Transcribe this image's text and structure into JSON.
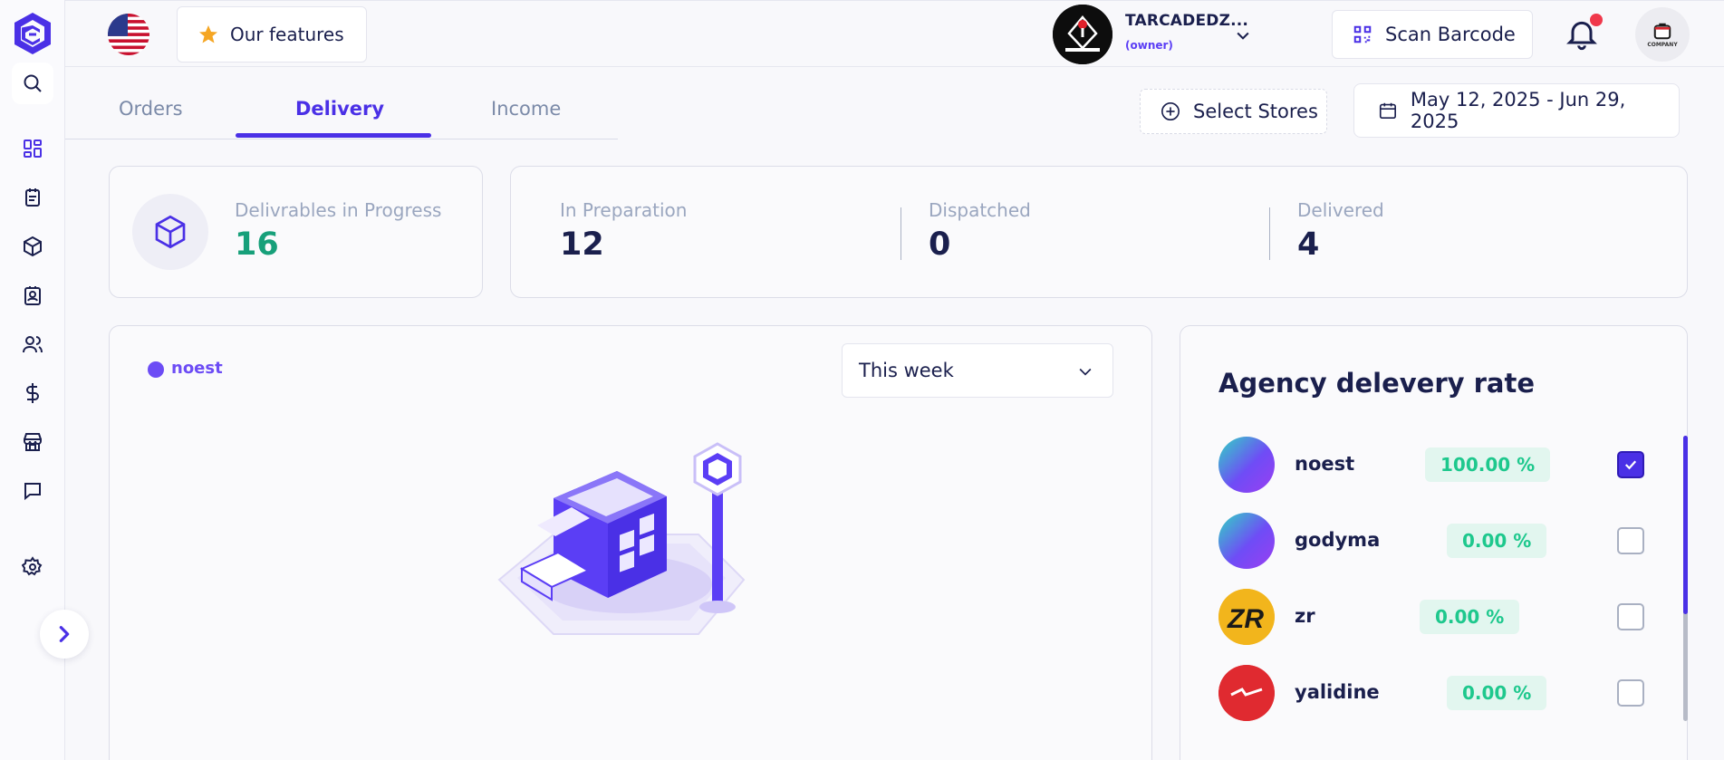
{
  "colors": {
    "accent": "#4a30e6",
    "value_green": "#17a07a",
    "rate_green": "#1ec88d",
    "legend_purple": "#6c4cf5",
    "notification": "#f0384b"
  },
  "sidebar": {
    "icons": [
      "dashboard-icon",
      "orders-icon",
      "products-icon",
      "contacts-icon",
      "users-icon",
      "dollar-icon",
      "store-icon",
      "chat-icon",
      "settings-icon"
    ]
  },
  "header": {
    "features_label": "Our features",
    "account": {
      "name": "TARCADEDZ...",
      "role": "(owner)"
    },
    "scan_label": "Scan Barcode",
    "company_label": "COMPANY"
  },
  "tabs": [
    {
      "label": "Orders",
      "active": false
    },
    {
      "label": "Delivery",
      "active": true
    },
    {
      "label": "Income",
      "active": false
    }
  ],
  "filters": {
    "stores_label": "Select Stores",
    "date_range": "May 12, 2025 - Jun 29, 2025"
  },
  "stats": {
    "in_progress": {
      "label": "Delivrables in Progress",
      "value": "16"
    },
    "preparation": {
      "label": "In Preparation",
      "value": "12"
    },
    "dispatched": {
      "label": "Dispatched",
      "value": "0"
    },
    "delivered": {
      "label": "Delivered",
      "value": "4"
    }
  },
  "chart_panel": {
    "legend": "noest",
    "period": "This week"
  },
  "agency": {
    "title": "Agency delevery rate",
    "rows": [
      {
        "name": "noest",
        "rate": "100.00 %",
        "checked": true,
        "avatar": "gradient"
      },
      {
        "name": "godyma",
        "rate": "0.00 %",
        "checked": false,
        "avatar": "gradient"
      },
      {
        "name": "zr",
        "rate": "0.00 %",
        "checked": false,
        "avatar": "zr-logo"
      },
      {
        "name": "yalidine",
        "rate": "0.00 %",
        "checked": false,
        "avatar": "yalidine-logo"
      }
    ]
  }
}
